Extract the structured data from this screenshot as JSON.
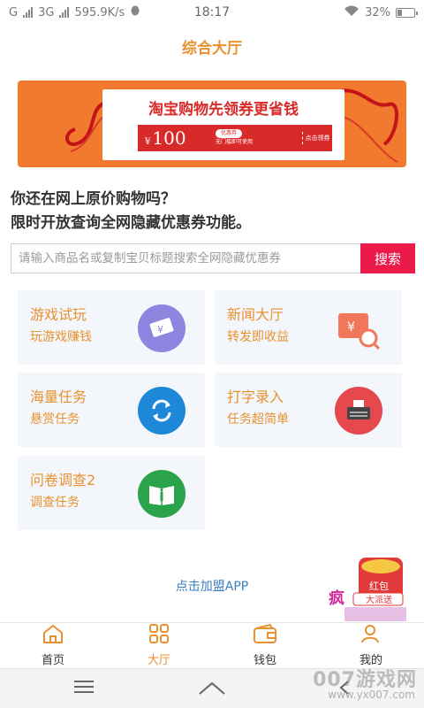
{
  "status_bar": {
    "carrier": "G",
    "network": "3G",
    "speed": "595.9K/s",
    "time": "18:17",
    "battery": "32%",
    "battery_level": 0.32
  },
  "header": {
    "title": "综合大厅"
  },
  "banner": {
    "headline": "淘宝购物先领券更省钱",
    "coupon_currency": "¥",
    "coupon_amount": "100",
    "coupon_tag": "优惠券",
    "coupon_note": "无门槛即可使用",
    "coupon_action": "点击领券"
  },
  "intro": {
    "line1": "你还在网上原价购物吗？",
    "line2": "限时开放查询全网隐藏优惠券功能。"
  },
  "search": {
    "placeholder": "请输入商品名或复制宝贝标题搜索全网隐藏优惠券",
    "value": "",
    "button_label": "搜索"
  },
  "tasks": [
    {
      "title": "游戏试玩",
      "subtitle": "玩游戏赚钱",
      "icon": "money-bill-icon",
      "color": "#8f84e0"
    },
    {
      "title": "新闻大厅",
      "subtitle": "转发即收益",
      "icon": "coupon-search-icon",
      "color": "#f0775a"
    },
    {
      "title": "海量任务",
      "subtitle": "悬赏任务",
      "icon": "refresh-icon",
      "color": "#1e88d8"
    },
    {
      "title": "打字录入",
      "subtitle": "任务超简单",
      "icon": "typewriter-icon",
      "color": "#e5484d"
    },
    {
      "title": "问卷调查2",
      "subtitle": "调查任务",
      "icon": "book-info-icon",
      "color": "#2aa34a"
    }
  ],
  "join_link": "点击加盟APP",
  "floating_ad": {
    "top_text": "红包",
    "bottom_text": "大派送",
    "side_text": "疯"
  },
  "tabbar": {
    "items": [
      {
        "label": "首页",
        "icon": "home-icon",
        "active": false
      },
      {
        "label": "大厅",
        "icon": "grid-icon",
        "active": true
      },
      {
        "label": "钱包",
        "icon": "wallet-icon",
        "active": false
      },
      {
        "label": "我的",
        "icon": "user-icon",
        "active": false
      }
    ]
  },
  "watermark": {
    "brand": "007游戏网",
    "url": "www.yx007.com"
  },
  "colors": {
    "accent": "#e8922f",
    "search_button": "#ea1b4b",
    "banner_bg": "#f17a2e",
    "card_bg": "#f3f6fb"
  }
}
